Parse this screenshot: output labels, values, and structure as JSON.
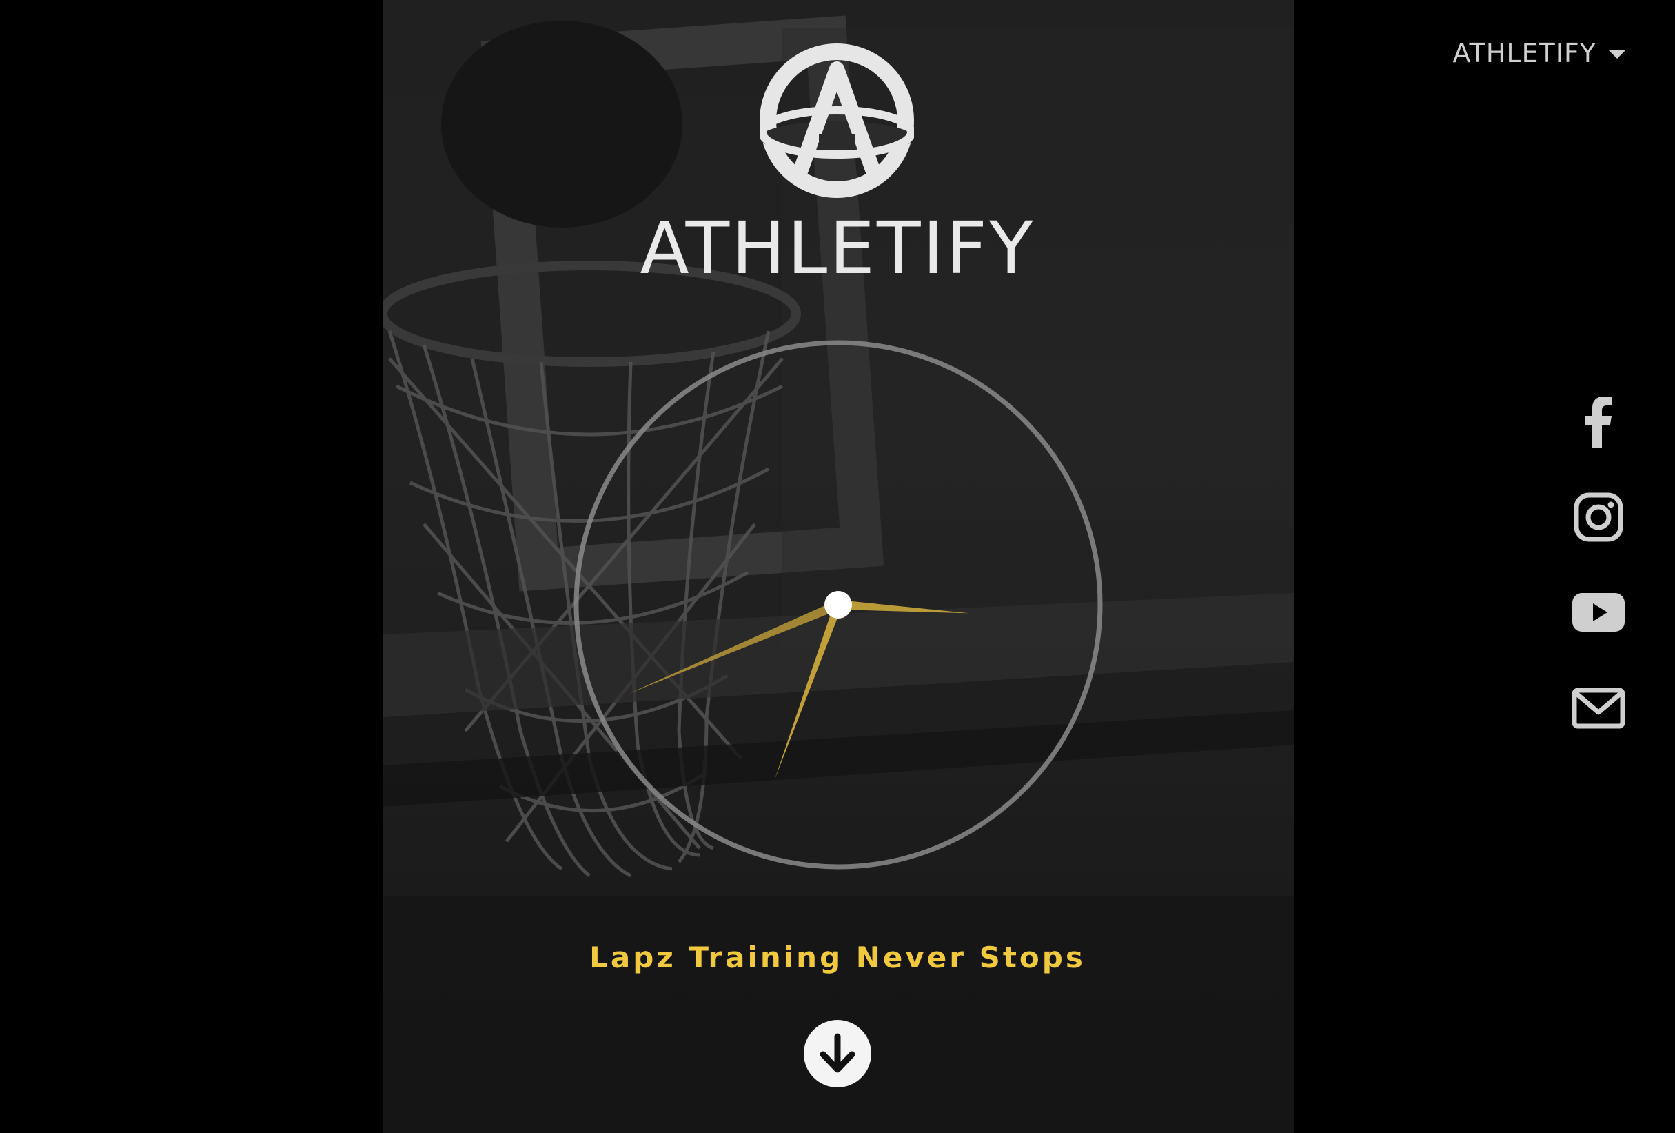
{
  "brand": {
    "name": "ATHLETIFY",
    "logo_letter": "A"
  },
  "nav": {
    "menu_label": "ATHLETIFY"
  },
  "hero": {
    "tagline": "Lapz Training Never Stops",
    "background": "basketball-hoop-photo"
  },
  "clock": {
    "hour": 7,
    "minute": 15,
    "second": 37,
    "hand_color": "#c9a73a",
    "ring_color": "#8a8a8a"
  },
  "social": [
    {
      "name": "facebook-icon"
    },
    {
      "name": "instagram-icon"
    },
    {
      "name": "youtube-icon"
    },
    {
      "name": "email-icon"
    }
  ],
  "colors": {
    "background": "#000000",
    "accent": "#f1c93f",
    "text": "#e9e9e9",
    "icons": "#cfcfcf"
  }
}
